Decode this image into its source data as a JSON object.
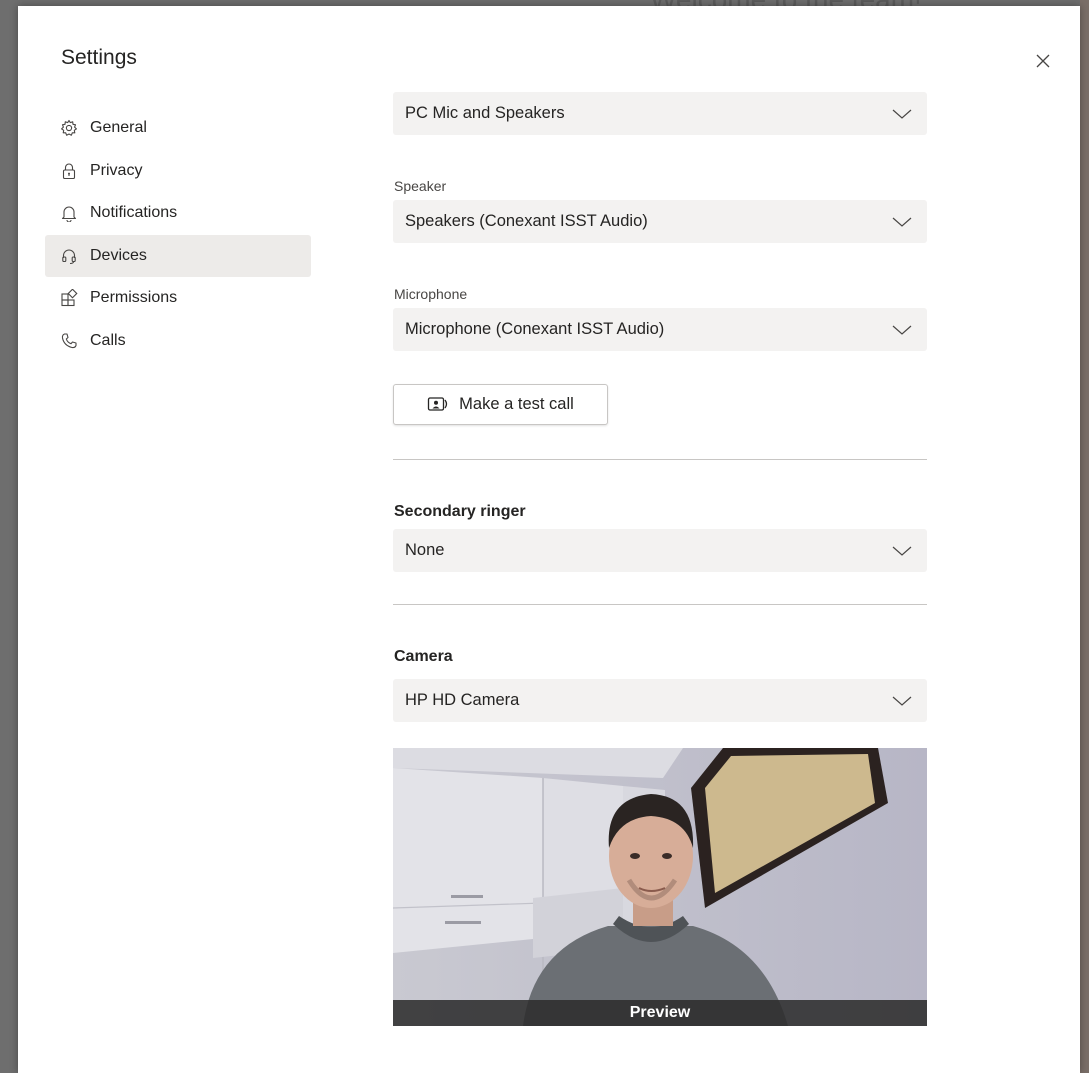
{
  "background": {
    "title": "Welcome to the team!"
  },
  "dialog": {
    "title": "Settings",
    "close_icon": "close-icon"
  },
  "nav": {
    "items": [
      {
        "label": "General",
        "icon": "gear-icon",
        "active": false
      },
      {
        "label": "Privacy",
        "icon": "lock-icon",
        "active": false
      },
      {
        "label": "Notifications",
        "icon": "bell-icon",
        "active": false
      },
      {
        "label": "Devices",
        "icon": "headset-icon",
        "active": true
      },
      {
        "label": "Permissions",
        "icon": "permissions-icon",
        "active": false
      },
      {
        "label": "Calls",
        "icon": "phone-icon",
        "active": false
      }
    ]
  },
  "devices": {
    "audio_device": "PC Mic and Speakers",
    "speaker_label": "Speaker",
    "speaker_value": "Speakers (Conexant ISST Audio)",
    "microphone_label": "Microphone",
    "microphone_value": "Microphone (Conexant ISST Audio)",
    "test_call_label": "Make a test call",
    "secondary_ringer_title": "Secondary ringer",
    "secondary_ringer_value": "None",
    "camera_title": "Camera",
    "camera_value": "HP HD Camera",
    "preview_label": "Preview"
  },
  "colors": {
    "active_nav_bg": "#edebe9",
    "dropdown_bg": "#f3f2f1",
    "text": "#252423"
  }
}
